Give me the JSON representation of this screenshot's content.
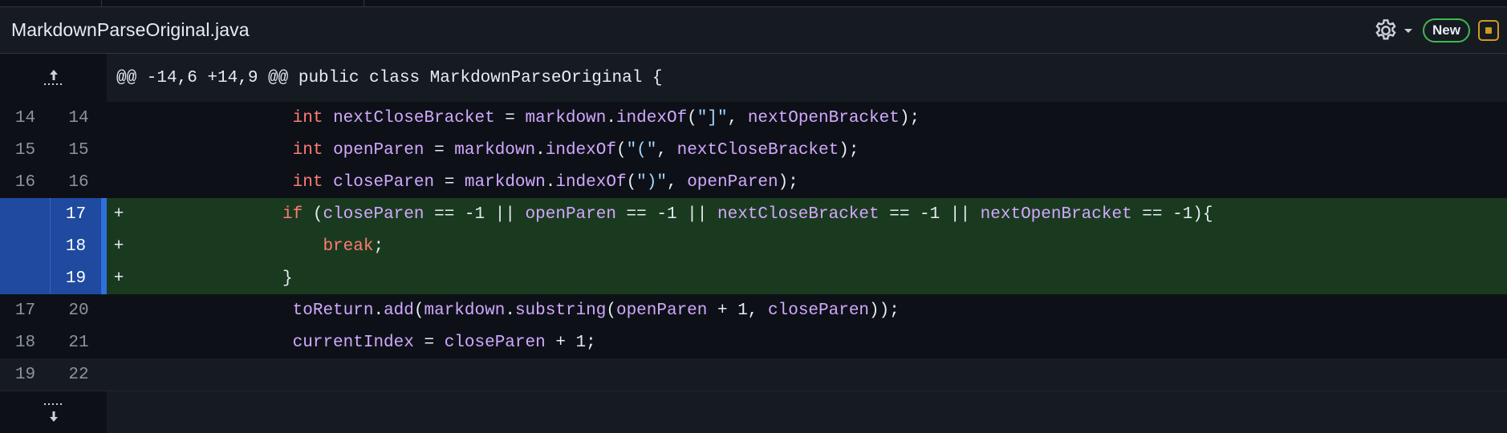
{
  "file": {
    "name": "MarkdownParseOriginal.java"
  },
  "toolbar": {
    "new_label": "New"
  },
  "hunk": {
    "header": "@@ -14,6 +14,9 @@ public class MarkdownParseOriginal {"
  },
  "lines": [
    {
      "type": "ctx",
      "old": "14",
      "new": "14",
      "marker": " ",
      "tokens": [
        {
          "t": "                ",
          "c": "plain"
        },
        {
          "t": "int",
          "c": "kw"
        },
        {
          "t": " ",
          "c": "plain"
        },
        {
          "t": "nextCloseBracket",
          "c": "var"
        },
        {
          "t": " = ",
          "c": "plain"
        },
        {
          "t": "markdown",
          "c": "var"
        },
        {
          "t": ".",
          "c": "plain"
        },
        {
          "t": "indexOf",
          "c": "fn"
        },
        {
          "t": "(",
          "c": "plain"
        },
        {
          "t": "\"]\"",
          "c": "str"
        },
        {
          "t": ", ",
          "c": "plain"
        },
        {
          "t": "nextOpenBracket",
          "c": "var"
        },
        {
          "t": ");",
          "c": "plain"
        }
      ]
    },
    {
      "type": "ctx",
      "old": "15",
      "new": "15",
      "marker": " ",
      "tokens": [
        {
          "t": "                ",
          "c": "plain"
        },
        {
          "t": "int",
          "c": "kw"
        },
        {
          "t": " ",
          "c": "plain"
        },
        {
          "t": "openParen",
          "c": "var"
        },
        {
          "t": " = ",
          "c": "plain"
        },
        {
          "t": "markdown",
          "c": "var"
        },
        {
          "t": ".",
          "c": "plain"
        },
        {
          "t": "indexOf",
          "c": "fn"
        },
        {
          "t": "(",
          "c": "plain"
        },
        {
          "t": "\"(\"",
          "c": "str"
        },
        {
          "t": ", ",
          "c": "plain"
        },
        {
          "t": "nextCloseBracket",
          "c": "var"
        },
        {
          "t": ");",
          "c": "plain"
        }
      ]
    },
    {
      "type": "ctx",
      "old": "16",
      "new": "16",
      "marker": " ",
      "tokens": [
        {
          "t": "                ",
          "c": "plain"
        },
        {
          "t": "int",
          "c": "kw"
        },
        {
          "t": " ",
          "c": "plain"
        },
        {
          "t": "closeParen",
          "c": "var"
        },
        {
          "t": " = ",
          "c": "plain"
        },
        {
          "t": "markdown",
          "c": "var"
        },
        {
          "t": ".",
          "c": "plain"
        },
        {
          "t": "indexOf",
          "c": "fn"
        },
        {
          "t": "(",
          "c": "plain"
        },
        {
          "t": "\")\"",
          "c": "str"
        },
        {
          "t": ", ",
          "c": "plain"
        },
        {
          "t": "openParen",
          "c": "var"
        },
        {
          "t": ");",
          "c": "plain"
        }
      ]
    },
    {
      "type": "add",
      "old": "",
      "new": "17",
      "marker": "+",
      "tokens": [
        {
          "t": "               ",
          "c": "plain"
        },
        {
          "t": "if",
          "c": "kw"
        },
        {
          "t": " (",
          "c": "plain"
        },
        {
          "t": "closeParen",
          "c": "var"
        },
        {
          "t": " == -1 || ",
          "c": "plain"
        },
        {
          "t": "openParen",
          "c": "var"
        },
        {
          "t": " == -1 || ",
          "c": "plain"
        },
        {
          "t": "nextCloseBracket",
          "c": "var"
        },
        {
          "t": " == -1 || ",
          "c": "plain"
        },
        {
          "t": "nextOpenBracket",
          "c": "var"
        },
        {
          "t": " == -1){",
          "c": "plain"
        }
      ]
    },
    {
      "type": "add",
      "old": "",
      "new": "18",
      "marker": "+",
      "tokens": [
        {
          "t": "                   ",
          "c": "plain"
        },
        {
          "t": "break",
          "c": "kw"
        },
        {
          "t": ";",
          "c": "plain"
        }
      ]
    },
    {
      "type": "add",
      "old": "",
      "new": "19",
      "marker": "+",
      "tokens": [
        {
          "t": "               ",
          "c": "plain"
        },
        {
          "t": "}",
          "c": "plain"
        }
      ]
    },
    {
      "type": "ctx",
      "old": "17",
      "new": "20",
      "marker": " ",
      "tokens": [
        {
          "t": "                ",
          "c": "plain"
        },
        {
          "t": "toReturn",
          "c": "var"
        },
        {
          "t": ".",
          "c": "plain"
        },
        {
          "t": "add",
          "c": "fn"
        },
        {
          "t": "(",
          "c": "plain"
        },
        {
          "t": "markdown",
          "c": "var"
        },
        {
          "t": ".",
          "c": "plain"
        },
        {
          "t": "substring",
          "c": "fn"
        },
        {
          "t": "(",
          "c": "plain"
        },
        {
          "t": "openParen",
          "c": "var"
        },
        {
          "t": " + 1, ",
          "c": "plain"
        },
        {
          "t": "closeParen",
          "c": "var"
        },
        {
          "t": "));",
          "c": "plain"
        }
      ]
    },
    {
      "type": "ctx",
      "old": "18",
      "new": "21",
      "marker": " ",
      "tokens": [
        {
          "t": "                ",
          "c": "plain"
        },
        {
          "t": "currentIndex",
          "c": "var"
        },
        {
          "t": " = ",
          "c": "plain"
        },
        {
          "t": "closeParen",
          "c": "var"
        },
        {
          "t": " + 1;",
          "c": "plain"
        }
      ]
    },
    {
      "type": "ctx",
      "old": "19",
      "new": "22",
      "marker": " ",
      "tokens": []
    }
  ],
  "icons": {
    "gear": "gear-icon",
    "caret": "caret-down-icon",
    "expand_up": "expand-up-icon",
    "expand_down": "expand-down-icon",
    "review": "review-square-icon"
  },
  "colors": {
    "accent_green": "#3fb950",
    "accent_orange": "#d29922",
    "addition_bg": "#1a3a1f",
    "addition_gutter": "#1f4aa0"
  }
}
